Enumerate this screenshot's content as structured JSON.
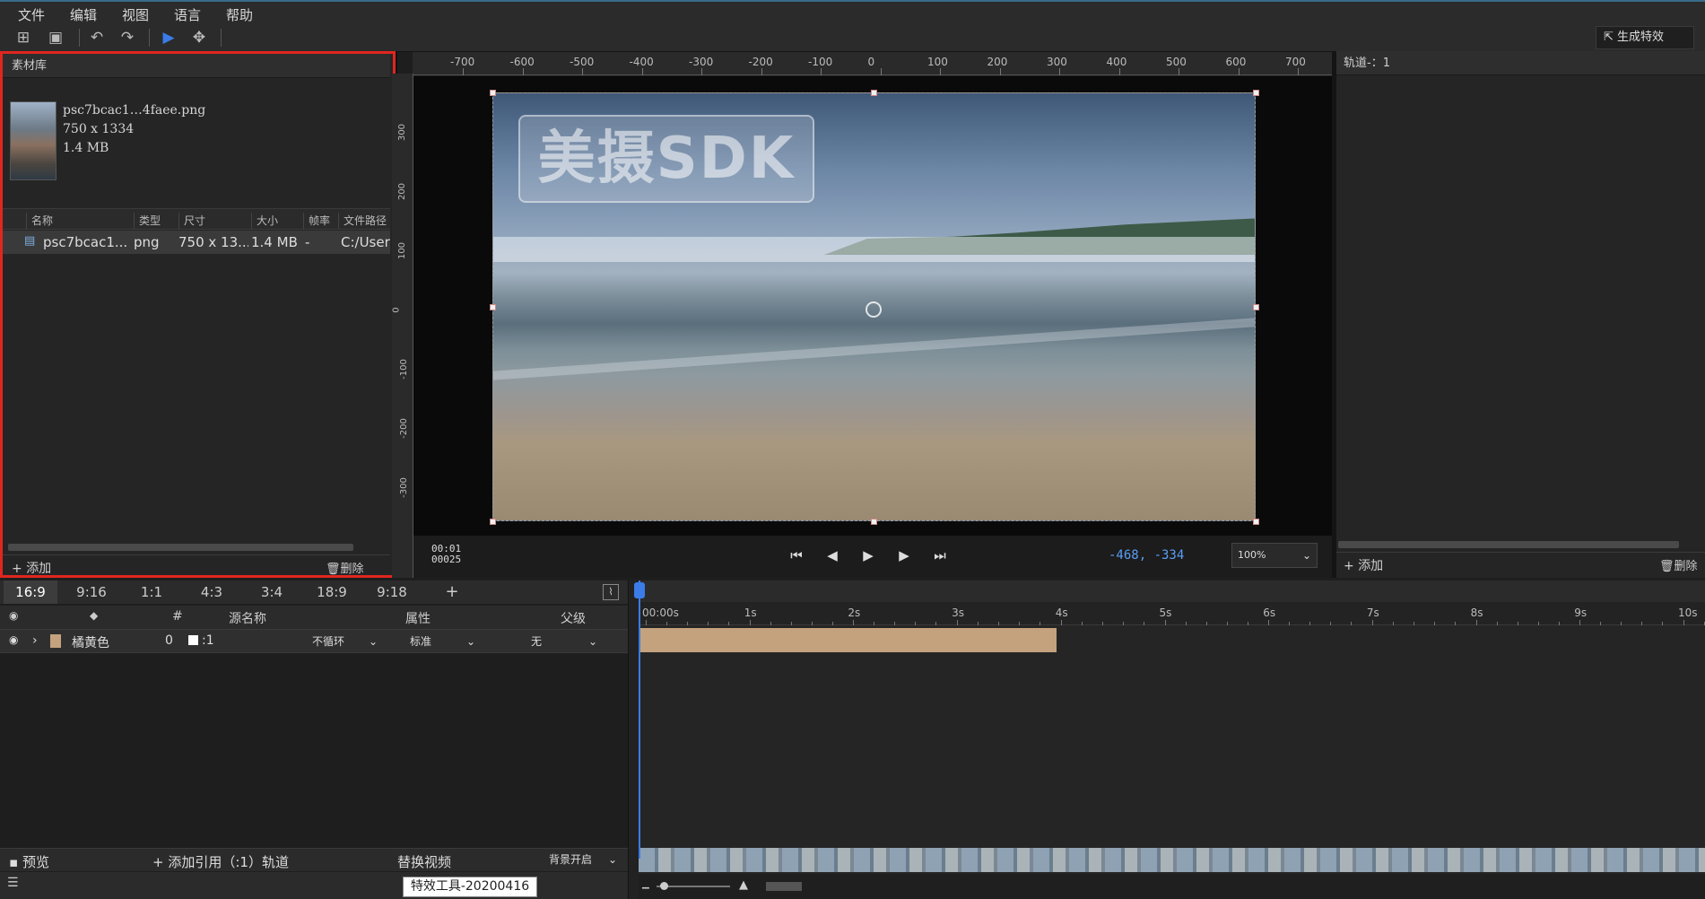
{
  "menu": [
    "文件",
    "编辑",
    "视图",
    "语言",
    "帮助"
  ],
  "toolbar": {
    "new_icon": "new-file-icon",
    "save_icon": "save-icon",
    "undo_icon": "undo-icon",
    "redo_icon": "redo-icon",
    "select_icon": "pointer-icon",
    "move_icon": "move-icon",
    "generate_label": "生成特效"
  },
  "library": {
    "title": "素材库",
    "preview": {
      "name": "psc7bcac1…4faee.png",
      "dims": "750 x 1334",
      "size": "1.4 MB"
    },
    "columns": [
      "名称",
      "类型",
      "尺寸",
      "大小",
      "帧率",
      "文件路径"
    ],
    "rows": [
      {
        "name": "psc7bcac1...",
        "type": "png",
        "dims": "750 x 13...",
        "size": "1.4 MB",
        "fps": "-",
        "path": "C:/User"
      }
    ],
    "add_label": "添加",
    "delete_label": "删除"
  },
  "ruler": {
    "h": [
      "-700",
      "-600",
      "-500",
      "-400",
      "-300",
      "-200",
      "-100",
      "0",
      "100",
      "200",
      "300",
      "400",
      "500",
      "600",
      "700"
    ],
    "v": [
      "300",
      "200",
      "100",
      "0",
      "-100",
      "-200",
      "-300"
    ]
  },
  "stage": {
    "watermark": "美摄SDK"
  },
  "player": {
    "time_top": "00:01",
    "time_bottom": "00025",
    "coords": "-468, -334",
    "zoom": "100%"
  },
  "track": {
    "title": "轨道-：1",
    "add_label": "添加",
    "delete_label": "删除"
  },
  "ratios": [
    "16:9",
    "9:16",
    "1:1",
    "4:3",
    "3:4",
    "18:9",
    "9:18",
    "+"
  ],
  "layers": {
    "headers": {
      "hash": "#",
      "source": "源名称",
      "props": "属性",
      "parent": "父级"
    },
    "row": {
      "name": "橘黄色",
      "index": "0",
      "source": ":1",
      "loop": "不循环",
      "blend": "标准",
      "parent": "无"
    }
  },
  "footer": {
    "preview": "预览",
    "add_track": "添加引用（:1）轨道",
    "replace": "替换视频",
    "bg": "背景开启"
  },
  "tooltip": "特效工具-20200416",
  "timeline": {
    "ticks": [
      "00:00s",
      "1s",
      "2s",
      "3s",
      "4s",
      "5s",
      "6s",
      "7s",
      "8s",
      "9s",
      "10s"
    ]
  },
  "colors": {
    "accent": "#3b7ce8",
    "clip": "#c4a27e",
    "highlight": "#e0261f"
  }
}
